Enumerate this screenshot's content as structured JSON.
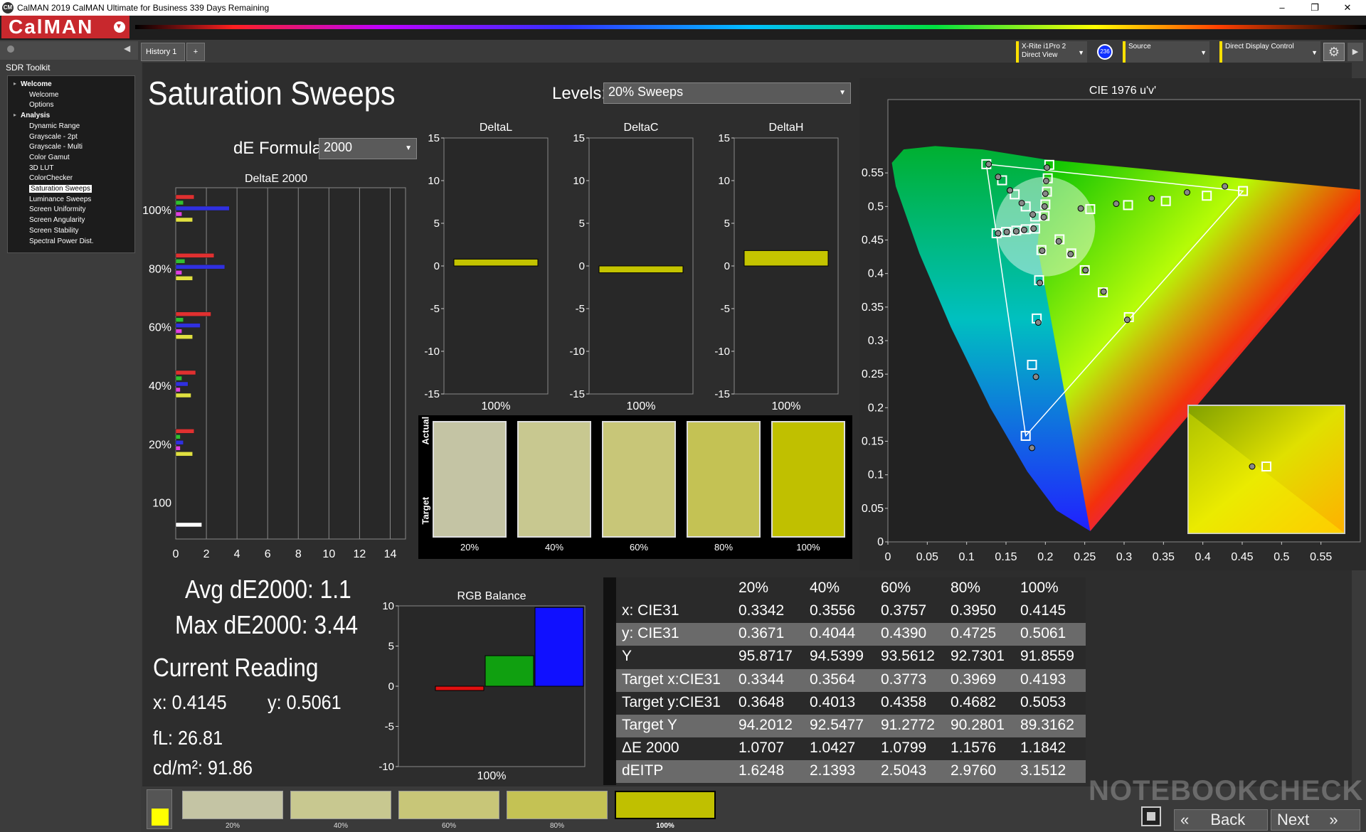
{
  "window": {
    "title": "CalMAN 2019 CalMAN Ultimate for Business 339 Days Remaining",
    "app_icon": "CM",
    "minimize": "–",
    "restore": "❐",
    "close": "✕"
  },
  "logo": "CalMAN",
  "logo_dropdown": "▼",
  "left_panel": {
    "back_arrow": "◀",
    "title": "SDR Toolkit",
    "tree": [
      {
        "label": "Welcome",
        "bold": true,
        "level": 0
      },
      {
        "label": "Welcome",
        "bold": false,
        "level": 1
      },
      {
        "label": "Options",
        "bold": false,
        "level": 1
      },
      {
        "label": "Analysis",
        "bold": true,
        "level": 0
      },
      {
        "label": "Dynamic Range",
        "bold": false,
        "level": 1
      },
      {
        "label": "Grayscale - 2pt",
        "bold": false,
        "level": 1
      },
      {
        "label": "Grayscale - Multi",
        "bold": false,
        "level": 1
      },
      {
        "label": "Color Gamut",
        "bold": false,
        "level": 1
      },
      {
        "label": "3D LUT",
        "bold": false,
        "level": 1
      },
      {
        "label": "ColorChecker",
        "bold": false,
        "level": 1
      },
      {
        "label": "Saturation Sweeps",
        "bold": false,
        "level": 1,
        "selected": true
      },
      {
        "label": "Luminance Sweeps",
        "bold": false,
        "level": 1
      },
      {
        "label": "Screen Uniformity",
        "bold": false,
        "level": 1
      },
      {
        "label": "Screen Angularity",
        "bold": false,
        "level": 1
      },
      {
        "label": "Screen Stability",
        "bold": false,
        "level": 1
      },
      {
        "label": "Spectral Power Dist.",
        "bold": false,
        "level": 1
      }
    ]
  },
  "tabs": [
    {
      "label": "History 1"
    },
    {
      "label": "+"
    }
  ],
  "toolbar": {
    "meter_line1": "X-Rite i1Pro 2",
    "meter_line2": "Direct View",
    "meter_badge": "236",
    "source": "Source",
    "display": "Direct Display Control",
    "settings_glyph": "⚙",
    "right_arrow": "▶"
  },
  "main": {
    "title": "Saturation Sweeps",
    "levels_label": "Levels:",
    "levels_value": "20% Sweeps",
    "de_formula_label": "dE Formula:",
    "de_formula_value": "2000"
  },
  "chart_data": [
    {
      "type": "bar",
      "title": "DeltaE 2000",
      "orientation": "horizontal",
      "categories": [
        "100%",
        "80%",
        "60%",
        "40%",
        "20%",
        "100"
      ],
      "xticks": [
        0,
        2,
        4,
        6,
        8,
        10,
        12,
        14
      ],
      "xlim": [
        0,
        15
      ],
      "series": [
        {
          "color": "#e03030",
          "values": [
            1.2,
            2.5,
            2.3,
            1.3,
            1.2,
            0
          ]
        },
        {
          "color": "#30c030",
          "values": [
            0.5,
            0.6,
            0.5,
            0.4,
            0.3,
            0
          ]
        },
        {
          "color": "#3030e0",
          "values": [
            3.5,
            3.2,
            1.6,
            0.8,
            0.5,
            0
          ]
        },
        {
          "color": "#e040e0",
          "values": [
            0.4,
            0.4,
            0.4,
            0.3,
            0.3,
            0
          ]
        },
        {
          "color": "#e0e040",
          "values": [
            1.1,
            1.1,
            1.1,
            1.0,
            1.1,
            0
          ]
        },
        {
          "color": "#ffffff",
          "values": [
            0,
            0,
            0,
            0,
            0,
            1.7
          ]
        }
      ]
    },
    {
      "type": "bar",
      "title": "DeltaL",
      "categories": [
        "100%"
      ],
      "values": [
        0.8
      ],
      "ylim": [
        -15,
        15
      ],
      "yticks": [
        15,
        10,
        5,
        0,
        -5,
        -10,
        -15
      ]
    },
    {
      "type": "bar",
      "title": "DeltaC",
      "categories": [
        "100%"
      ],
      "values": [
        -0.8
      ],
      "ylim": [
        -15,
        15
      ],
      "yticks": [
        15,
        10,
        5,
        0,
        -5,
        -10,
        -15
      ]
    },
    {
      "type": "bar",
      "title": "DeltaH",
      "categories": [
        "100%"
      ],
      "values": [
        1.8
      ],
      "ylim": [
        -15,
        15
      ],
      "yticks": [
        15,
        10,
        5,
        0,
        -5,
        -10,
        -15
      ]
    },
    {
      "type": "bar",
      "title": "RGB Balance",
      "categories": [
        "100%"
      ],
      "series": [
        {
          "color": "#e01010",
          "value": -0.5
        },
        {
          "color": "#10a010",
          "value": 3.8
        },
        {
          "color": "#1010ff",
          "value": 9.8
        }
      ],
      "ylim": [
        -10,
        10
      ],
      "yticks": [
        10,
        5,
        0,
        -5,
        -10
      ]
    },
    {
      "type": "scatter",
      "title": "CIE 1976 u'v'",
      "xticks": [
        0,
        0.05,
        0.1,
        0.15,
        0.2,
        0.25,
        0.3,
        0.35,
        0.4,
        0.45,
        0.5,
        0.55
      ],
      "yticks": [
        0,
        0.05,
        0.1,
        0.15,
        0.2,
        0.25,
        0.3,
        0.35,
        0.4,
        0.45,
        0.5,
        0.55
      ],
      "xlim": [
        0,
        0.6
      ],
      "ylim": [
        0,
        0.6
      ],
      "primaries_target": [
        [
          0.451,
          0.523
        ],
        [
          0.125,
          0.563
        ],
        [
          0.175,
          0.158
        ]
      ],
      "white": [
        0.1978,
        0.4683
      ],
      "targets": [
        [
          0.451,
          0.523
        ],
        [
          0.405,
          0.516
        ],
        [
          0.353,
          0.508
        ],
        [
          0.305,
          0.502
        ],
        [
          0.257,
          0.496
        ],
        [
          0.125,
          0.563
        ],
        [
          0.145,
          0.539
        ],
        [
          0.161,
          0.518
        ],
        [
          0.175,
          0.5
        ],
        [
          0.187,
          0.485
        ],
        [
          0.175,
          0.158
        ],
        [
          0.183,
          0.264
        ],
        [
          0.189,
          0.333
        ],
        [
          0.192,
          0.39
        ],
        [
          0.195,
          0.435
        ],
        [
          0.205,
          0.562
        ],
        [
          0.203,
          0.542
        ],
        [
          0.202,
          0.522
        ],
        [
          0.2,
          0.503
        ],
        [
          0.199,
          0.486
        ],
        [
          0.306,
          0.335
        ],
        [
          0.273,
          0.372
        ],
        [
          0.25,
          0.405
        ],
        [
          0.233,
          0.43
        ],
        [
          0.218,
          0.451
        ],
        [
          0.138,
          0.46
        ],
        [
          0.15,
          0.462
        ],
        [
          0.163,
          0.464
        ],
        [
          0.175,
          0.466
        ],
        [
          0.187,
          0.467
        ]
      ],
      "measured": [
        [
          0.428,
          0.53
        ],
        [
          0.38,
          0.521
        ],
        [
          0.335,
          0.512
        ],
        [
          0.29,
          0.504
        ],
        [
          0.245,
          0.497
        ],
        [
          0.128,
          0.563
        ],
        [
          0.14,
          0.544
        ],
        [
          0.155,
          0.524
        ],
        [
          0.17,
          0.505
        ],
        [
          0.184,
          0.488
        ],
        [
          0.183,
          0.14
        ],
        [
          0.188,
          0.246
        ],
        [
          0.191,
          0.327
        ],
        [
          0.193,
          0.386
        ],
        [
          0.196,
          0.434
        ],
        [
          0.202,
          0.558
        ],
        [
          0.201,
          0.538
        ],
        [
          0.2,
          0.519
        ],
        [
          0.199,
          0.5
        ],
        [
          0.198,
          0.484
        ],
        [
          0.304,
          0.331
        ],
        [
          0.274,
          0.373
        ],
        [
          0.251,
          0.405
        ],
        [
          0.232,
          0.429
        ],
        [
          0.217,
          0.448
        ],
        [
          0.14,
          0.46
        ],
        [
          0.151,
          0.462
        ],
        [
          0.163,
          0.463
        ],
        [
          0.173,
          0.465
        ],
        [
          0.185,
          0.467
        ]
      ]
    }
  ],
  "deltaL_xlabel": "100%",
  "deltaC_xlabel": "100%",
  "deltaH_xlabel": "100%",
  "rgb_xlabel": "100%",
  "swatch_panel": {
    "actual_label": "Actual",
    "target_label": "Target",
    "swatches": [
      {
        "label": "20%",
        "color": "#c4c4a4"
      },
      {
        "label": "40%",
        "color": "#c8c890"
      },
      {
        "label": "60%",
        "color": "#c8c678"
      },
      {
        "label": "80%",
        "color": "#c4c254"
      },
      {
        "label": "100%",
        "color": "#c0c000"
      }
    ]
  },
  "stats": {
    "avg": "Avg dE2000: 1.1",
    "max": "Max dE2000: 3.44",
    "current_reading": "Current Reading",
    "x": "x: 0.4145",
    "y": "y: 0.5061",
    "fl": "fL: 26.81",
    "cdm": "cd/m²: 91.86"
  },
  "table": {
    "headers": [
      "20%",
      "40%",
      "60%",
      "80%",
      "100%"
    ],
    "rows": [
      {
        "label": "x: CIE31",
        "values": [
          "0.3342",
          "0.3556",
          "0.3757",
          "0.3950",
          "0.4145"
        ]
      },
      {
        "label": "y: CIE31",
        "values": [
          "0.3671",
          "0.4044",
          "0.4390",
          "0.4725",
          "0.5061"
        ]
      },
      {
        "label": "Y",
        "values": [
          "95.8717",
          "94.5399",
          "93.5612",
          "92.7301",
          "91.8559"
        ]
      },
      {
        "label": "Target x:CIE31",
        "values": [
          "0.3344",
          "0.3564",
          "0.3773",
          "0.3969",
          "0.4193"
        ]
      },
      {
        "label": "Target y:CIE31",
        "values": [
          "0.3648",
          "0.4013",
          "0.4358",
          "0.4682",
          "0.5053"
        ]
      },
      {
        "label": "Target Y",
        "values": [
          "94.2012",
          "92.5477",
          "91.2772",
          "90.2801",
          "89.3162"
        ]
      },
      {
        "label": "ΔE 2000",
        "values": [
          "1.0707",
          "1.0427",
          "1.0799",
          "1.1576",
          "1.1842"
        ]
      },
      {
        "label": "dEITP",
        "values": [
          "1.6248",
          "2.1393",
          "2.5043",
          "2.9760",
          "3.1512"
        ]
      }
    ]
  },
  "bottom": {
    "current_color": "#ffff00",
    "swatches": [
      {
        "label": "20%",
        "color": "#c4c4a4"
      },
      {
        "label": "40%",
        "color": "#c8c890"
      },
      {
        "label": "60%",
        "color": "#c8c678"
      },
      {
        "label": "80%",
        "color": "#c4c254"
      },
      {
        "label": "100%",
        "color": "#c0c000"
      }
    ],
    "back": "Back",
    "next": "Next",
    "back_icon": "«",
    "next_icon": "»"
  },
  "watermark": "NOTEBOOKCHECK"
}
